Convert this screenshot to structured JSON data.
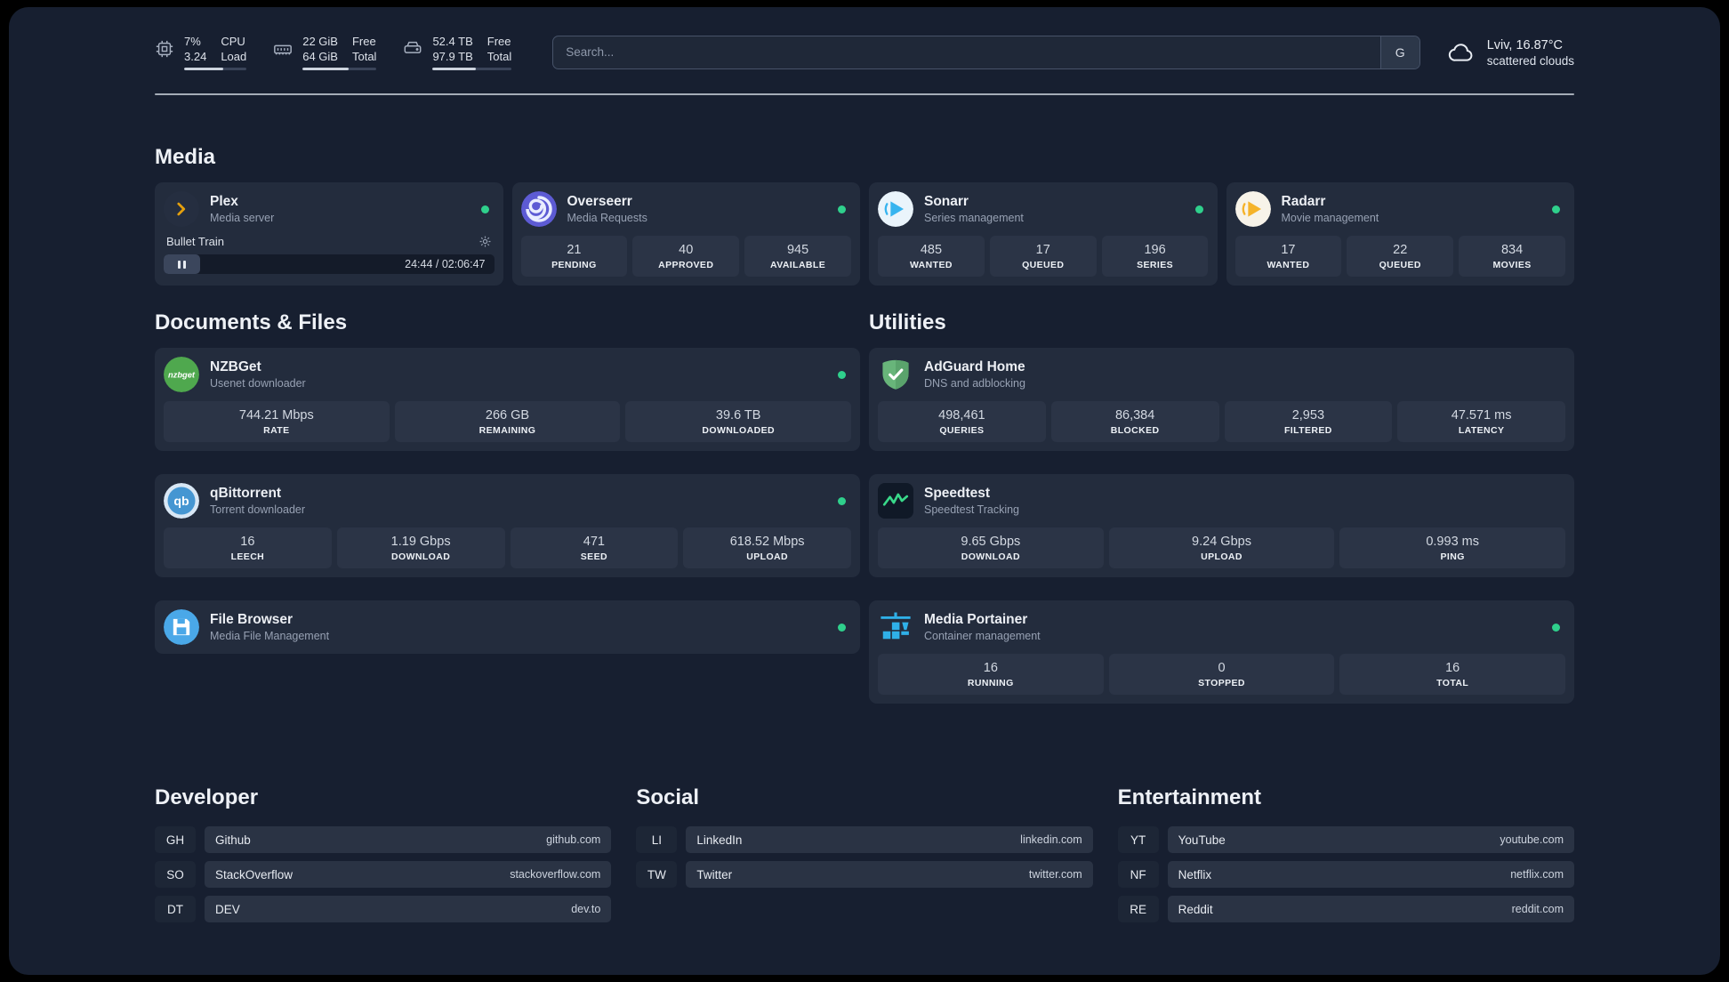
{
  "topbar": {
    "resources": [
      {
        "value_top": "7%",
        "value_bottom": "3.24",
        "label_top": "CPU",
        "label_bottom": "Load",
        "percent": 62
      },
      {
        "value_top": "22 GiB",
        "value_bottom": "64 GiB",
        "label_top": "Free",
        "label_bottom": "Total",
        "percent": 62
      },
      {
        "value_top": "52.4 TB",
        "value_bottom": "97.9 TB",
        "label_top": "Free",
        "label_bottom": "Total",
        "percent": 55
      }
    ],
    "search": {
      "placeholder": "Search...",
      "provider_button": "G"
    },
    "weather": {
      "location": "Lviv, 16.87°C",
      "condition": "scattered clouds"
    }
  },
  "sections": {
    "media": {
      "title": "Media",
      "cards": [
        {
          "name": "Plex",
          "subtitle": "Media server",
          "player": {
            "track": "Bullet Train",
            "time": "24:44 / 02:06:47",
            "progress_percent": 11
          }
        },
        {
          "name": "Overseerr",
          "subtitle": "Media Requests",
          "stats": [
            {
              "value": "21",
              "label": "PENDING"
            },
            {
              "value": "40",
              "label": "APPROVED"
            },
            {
              "value": "945",
              "label": "AVAILABLE"
            }
          ]
        },
        {
          "name": "Sonarr",
          "subtitle": "Series management",
          "stats": [
            {
              "value": "485",
              "label": "WANTED"
            },
            {
              "value": "17",
              "label": "QUEUED"
            },
            {
              "value": "196",
              "label": "SERIES"
            }
          ]
        },
        {
          "name": "Radarr",
          "subtitle": "Movie management",
          "stats": [
            {
              "value": "17",
              "label": "WANTED"
            },
            {
              "value": "22",
              "label": "QUEUED"
            },
            {
              "value": "834",
              "label": "MOVIES"
            }
          ]
        }
      ]
    },
    "documents": {
      "title": "Documents & Files",
      "cards": [
        {
          "name": "NZBGet",
          "subtitle": "Usenet downloader",
          "stats": [
            {
              "value": "744.21 Mbps",
              "label": "RATE"
            },
            {
              "value": "266 GB",
              "label": "REMAINING"
            },
            {
              "value": "39.6 TB",
              "label": "DOWNLOADED"
            }
          ]
        },
        {
          "name": "qBittorrent",
          "subtitle": "Torrent downloader",
          "stats": [
            {
              "value": "16",
              "label": "LEECH"
            },
            {
              "value": "1.19 Gbps",
              "label": "DOWNLOAD"
            },
            {
              "value": "471",
              "label": "SEED"
            },
            {
              "value": "618.52 Mbps",
              "label": "UPLOAD"
            }
          ]
        },
        {
          "name": "File Browser",
          "subtitle": "Media File Management",
          "stats": []
        }
      ]
    },
    "utilities": {
      "title": "Utilities",
      "cards": [
        {
          "name": "AdGuard Home",
          "subtitle": "DNS and adblocking",
          "stats": [
            {
              "value": "498,461",
              "label": "QUERIES"
            },
            {
              "value": "86,384",
              "label": "BLOCKED"
            },
            {
              "value": "2,953",
              "label": "FILTERED"
            },
            {
              "value": "47.571 ms",
              "label": "LATENCY"
            }
          ]
        },
        {
          "name": "Speedtest",
          "subtitle": "Speedtest Tracking",
          "stats": [
            {
              "value": "9.65 Gbps",
              "label": "DOWNLOAD"
            },
            {
              "value": "9.24 Gbps",
              "label": "UPLOAD"
            },
            {
              "value": "0.993 ms",
              "label": "PING"
            }
          ]
        },
        {
          "name": "Media Portainer",
          "subtitle": "Container management",
          "stats": [
            {
              "value": "16",
              "label": "RUNNING"
            },
            {
              "value": "0",
              "label": "STOPPED"
            },
            {
              "value": "16",
              "label": "TOTAL"
            }
          ]
        }
      ]
    },
    "bookmarks": [
      {
        "title": "Developer",
        "items": [
          {
            "abbr": "GH",
            "name": "Github",
            "domain": "github.com"
          },
          {
            "abbr": "SO",
            "name": "StackOverflow",
            "domain": "stackoverflow.com"
          },
          {
            "abbr": "DT",
            "name": "DEV",
            "domain": "dev.to"
          }
        ]
      },
      {
        "title": "Social",
        "items": [
          {
            "abbr": "LI",
            "name": "LinkedIn",
            "domain": "linkedin.com"
          },
          {
            "abbr": "TW",
            "name": "Twitter",
            "domain": "twitter.com"
          }
        ]
      },
      {
        "title": "Entertainment",
        "items": [
          {
            "abbr": "YT",
            "name": "YouTube",
            "domain": "youtube.com"
          },
          {
            "abbr": "NF",
            "name": "Netflix",
            "domain": "netflix.com"
          },
          {
            "abbr": "RE",
            "name": "Reddit",
            "domain": "reddit.com"
          }
        ]
      }
    ]
  },
  "colors": {
    "status_online": "#2fd08c",
    "panel_bg": "#171f30",
    "card_bg": "#232c3d",
    "tile_bg": "#2b3446"
  },
  "icons": {
    "cpu": "cpu-chip",
    "memory": "ram-module",
    "disk": "hard-drive",
    "weather": "cloud",
    "settings": "gear",
    "pause": "pause"
  }
}
